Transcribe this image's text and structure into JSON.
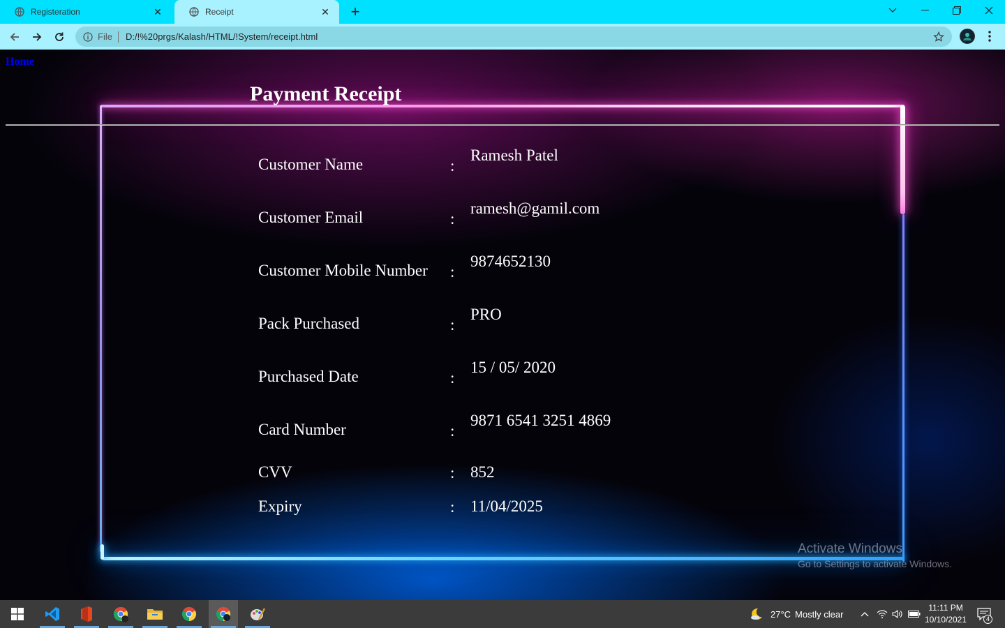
{
  "browser": {
    "tabs": [
      {
        "label": "Registeration",
        "active": false
      },
      {
        "label": "Receipt",
        "active": true
      }
    ],
    "address": {
      "scheme": "File",
      "url": "D:/!%20prgs/Kalash/HTML/!System/receipt.html"
    }
  },
  "page": {
    "home_link": "Home",
    "title": "Payment Receipt",
    "separator": ":",
    "rows": [
      {
        "label": "Customer Name",
        "value": "Ramesh Patel"
      },
      {
        "label": "Customer Email",
        "value": "ramesh@gamil.com"
      },
      {
        "label": "Customer Mobile Number",
        "value": "9874652130"
      },
      {
        "label": "Pack Purchased",
        "value": "PRO"
      },
      {
        "label": "Purchased Date",
        "value": "15 / 05/ 2020"
      },
      {
        "label": "Card Number",
        "value": "9871 6541 3251 4869"
      },
      {
        "label": "CVV",
        "value": "852"
      },
      {
        "label": "Expiry",
        "value": "11/04/2025"
      }
    ],
    "watermark": {
      "line1": "Activate Windows",
      "line2": "Go to Settings to activate Windows."
    }
  },
  "taskbar": {
    "weather": {
      "temp": "27°C",
      "condition": "Mostly clear"
    },
    "clock": {
      "time": "11:11 PM",
      "date": "10/10/2021"
    },
    "notifications": "4"
  },
  "colors": {
    "tab_strip": "#00e0ff",
    "toolbar": "#a8f2ff",
    "neon_pink": "#ff2fcf",
    "neon_blue": "#0a84ff",
    "link": "#0000ee"
  }
}
